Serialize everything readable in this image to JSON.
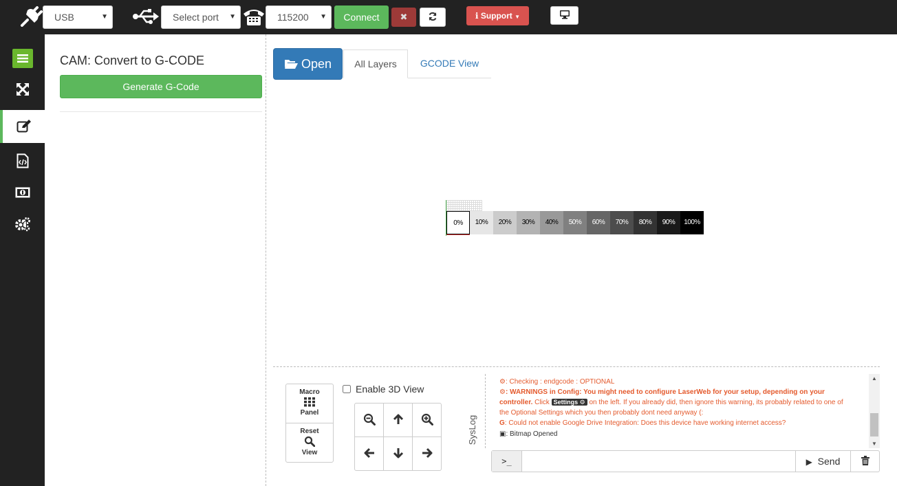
{
  "topbar": {
    "connection_type": "USB",
    "port_placeholder": "Select port",
    "baud": "115200",
    "connect_label": "Connect",
    "disconnect_label": "✖",
    "support_label": "Support"
  },
  "leftnav": {
    "items": [
      "menu-icon",
      "jog-icon",
      "edit-icon",
      "gcode-file-icon",
      "cash-icon",
      "settings-icon"
    ],
    "active_index": 2
  },
  "cam": {
    "title": "CAM: Convert to G-CODE",
    "generate_label": "Generate G-Code"
  },
  "main": {
    "open_label": "Open",
    "tabs": [
      {
        "label": "All Layers",
        "active": true
      },
      {
        "label": "GCODE View",
        "active": false
      }
    ],
    "strip_labels": [
      "0%",
      "10%",
      "20%",
      "30%",
      "40%",
      "50%",
      "60%",
      "70%",
      "80%",
      "90%",
      "100%"
    ],
    "strip_colors": [
      "#ffffff",
      "#e6e6e6",
      "#cccccc",
      "#b3b3b3",
      "#999999",
      "#808080",
      "#666666",
      "#4d4d4d",
      "#333333",
      "#1a1a1a",
      "#000000"
    ]
  },
  "controls": {
    "macro_label": "Macro",
    "panel_label": "Panel",
    "reset_label": "Reset",
    "view_label": "View",
    "enable_3d_label": "Enable 3D View"
  },
  "syslog": {
    "label": "SysLog",
    "line1": ": Checking : endgcode : OPTIONAL",
    "line2_bold": ": WARNINGS in Config: You might need to configure LaserWeb for your setup, depending on your",
    "line3a": "controller.",
    "line3b": " Click ",
    "settings_badge": "Settings",
    "line3c": " on the left. If you already did, then ignore this warning, its probably related to one of",
    "line4": "the Optional Settings which you then probably dont need anyway (:",
    "line5": ": Could not enable Google Drive Integration: Does this device have working internet access?",
    "line6": ": Bitmap Opened"
  },
  "console": {
    "prefix": ">_",
    "send_label": "Send"
  },
  "colors": {
    "success": "#5cb85c",
    "primary": "#337ab7",
    "danger": "#d9534f",
    "log_warning": "#e45a2d"
  }
}
